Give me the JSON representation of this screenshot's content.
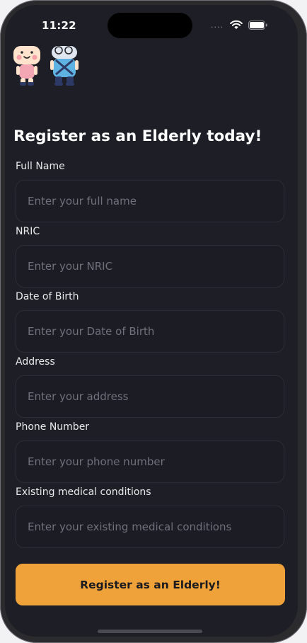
{
  "status_bar": {
    "time": "11:22"
  },
  "form": {
    "title": "Register as an Elderly today!",
    "fields": [
      {
        "label": "Full Name",
        "placeholder": "Enter your full name"
      },
      {
        "label": "NRIC",
        "placeholder": "Enter your NRIC"
      },
      {
        "label": "Date of Birth",
        "placeholder": "Enter your Date of Birth"
      },
      {
        "label": "Address",
        "placeholder": "Enter your address"
      },
      {
        "label": "Phone Number",
        "placeholder": "Enter your phone number"
      },
      {
        "label": "Existing medical conditions",
        "placeholder": "Enter your existing medical conditions"
      }
    ],
    "submit_label": "Register as an Elderly!"
  },
  "colors": {
    "background": "#1e1f26",
    "accent": "#f0a23a"
  }
}
